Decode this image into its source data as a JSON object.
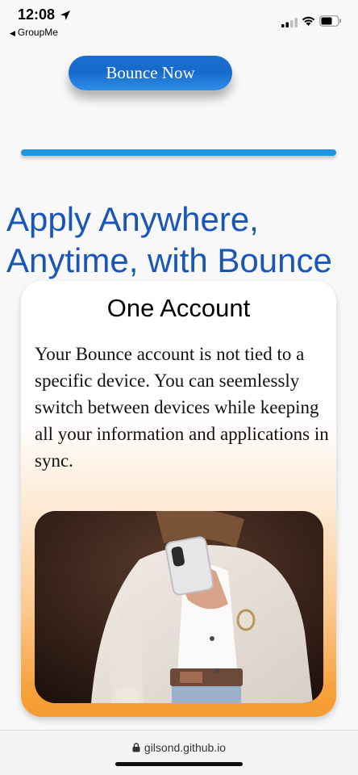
{
  "status_bar": {
    "time": "12:08",
    "back_app": "GroupMe"
  },
  "page": {
    "cta_label": "Bounce Now",
    "headline": "Apply Anywhere, Anytime, with Bounce",
    "card": {
      "title": "One Account",
      "body": "Your Bounce account is not tied to a specific device. You can seemlessly switch between devices while keeping all your information and applications in sync."
    }
  },
  "browser": {
    "url": "gilsond.github.io"
  },
  "colors": {
    "accent_blue": "#1669cc",
    "headline_blue": "#1a56b8",
    "divider_blue": "#1f95e0",
    "card_orange": "#f59b30"
  },
  "icons": [
    "location-arrow-icon",
    "back-triangle-icon",
    "signal-icon",
    "wifi-icon",
    "battery-icon",
    "lock-icon"
  ]
}
